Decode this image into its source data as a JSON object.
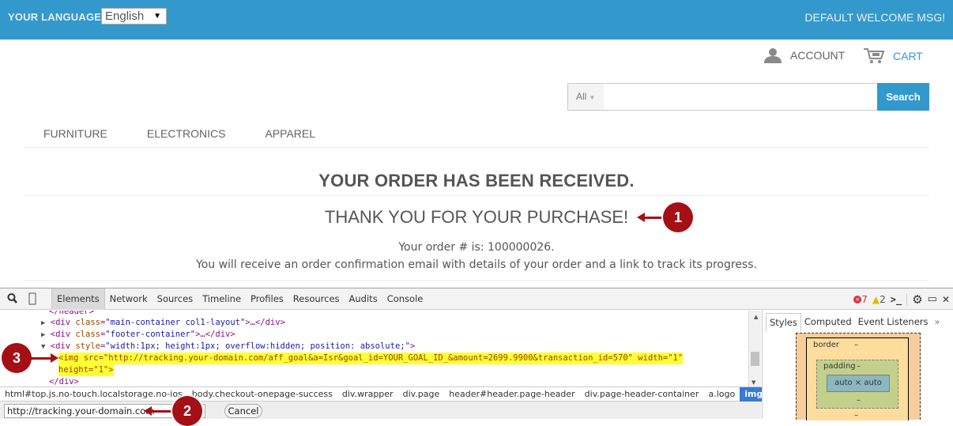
{
  "topbar": {
    "language_label": "YOUR LANGUAGE:",
    "language_value": "English",
    "welcome": "DEFAULT WELCOME MSG!",
    "bg_color": "#3399cc"
  },
  "header": {
    "account_label": "ACCOUNT",
    "cart_label": "CART",
    "search": {
      "category": "All",
      "placeholder": "",
      "button_label": "Search"
    }
  },
  "nav": {
    "items": [
      {
        "label": "FURNITURE"
      },
      {
        "label": "ELECTRONICS"
      },
      {
        "label": "APPAREL"
      }
    ]
  },
  "content": {
    "title": "YOUR ORDER HAS BEEN RECEIVED.",
    "thanks": "THANK YOU FOR YOUR PURCHASE!",
    "order_number_text": "Your order # is: 100000026.",
    "confirmation_text": "You will receive an order confirmation email with details of your order and a link to track its progress."
  },
  "callouts": [
    "1",
    "2",
    "3"
  ],
  "devtools": {
    "tabs": [
      {
        "label": "Elements",
        "active": true
      },
      {
        "label": "Network"
      },
      {
        "label": "Sources"
      },
      {
        "label": "Timeline"
      },
      {
        "label": "Profiles"
      },
      {
        "label": "Resources"
      },
      {
        "label": "Audits"
      },
      {
        "label": "Console"
      }
    ],
    "errors": "7",
    "warnings": "2",
    "dom": {
      "line0": "</header>",
      "line1_open": "<div ",
      "line1_attr": "class",
      "line1_val": "\"main-container col1-layout\"",
      "line1_close": ">…</div>",
      "line2_open": "<div ",
      "line2_attr": "class",
      "line2_val": "\"footer-container\"",
      "line2_close": ">…</div>",
      "line3_open": "<div ",
      "line3_attr": "style",
      "line3_val": "\"width:1px; height:1px; overflow:hidden; position: absolute;\"",
      "line3_close": ">",
      "line4_text": "<img src=\"http://tracking.your-domain.com/aff_goal&a=Isr&goal_id=YOUR_GOAL_ID_&amount=2699.9900&transaction_id=570\" width=\"1\"",
      "line5_text": "height=\"1\">",
      "line6": "</div>"
    },
    "breadcrumbs": [
      {
        "label": "html#top.js.no-touch.localstorage.no-ios"
      },
      {
        "label": "body.checkout-onepage-success"
      },
      {
        "label": "div.wrapper"
      },
      {
        "label": "div.page"
      },
      {
        "label": "header#header.page-header"
      },
      {
        "label": "div.page-header-container"
      },
      {
        "label": "a.logo"
      },
      {
        "label": "img.small",
        "active": true
      }
    ],
    "find_value": "http://tracking.your-domain.com",
    "cancel_label": "Cancel",
    "side_tabs": [
      {
        "label": "Styles",
        "active": true
      },
      {
        "label": "Computed"
      },
      {
        "label": "Event Listeners"
      },
      {
        "label": "»"
      }
    ],
    "box_model": {
      "border_label": "border",
      "padding_label": "padding",
      "dash": "–",
      "content_size": "auto × auto"
    }
  }
}
